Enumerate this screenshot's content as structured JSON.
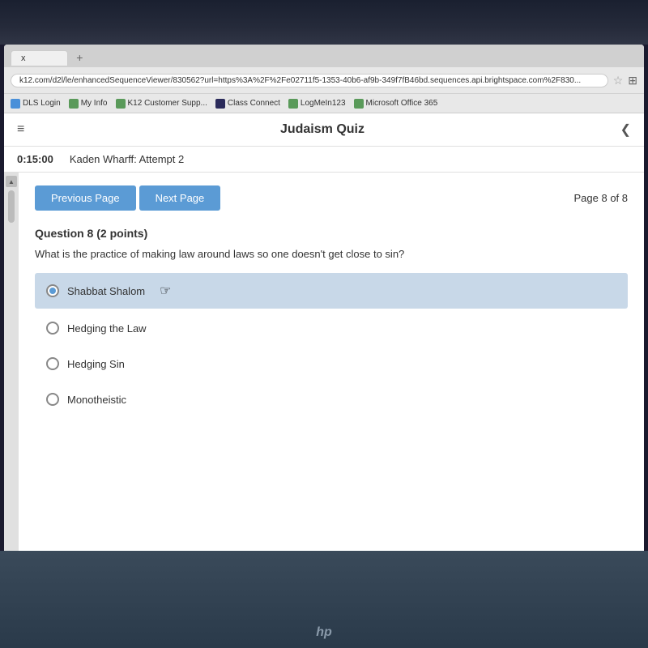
{
  "browser": {
    "url": "k12.com/d2l/le/enhancedSequenceViewer/830562?url=https%3A%2F%2Fe02711f5-1353-40b6-af9b-349f7fB46bd.sequences.api.brightspace.com%2F830...",
    "tab_label": "x",
    "tab_new": "+",
    "bookmarks": [
      {
        "label": "DLS Login",
        "color": "blue"
      },
      {
        "label": "My Info",
        "color": "green"
      },
      {
        "label": "K12 Customer Supp...",
        "color": "green"
      },
      {
        "label": "Class Connect",
        "color": "dark"
      },
      {
        "label": "LogMeIn123",
        "color": "green"
      },
      {
        "label": "Microsoft Office 365",
        "color": "green"
      }
    ]
  },
  "header": {
    "title": "Judaism Quiz",
    "hamburger": "≡",
    "nav_arrow": "❮"
  },
  "timer": {
    "time": "0:15:00",
    "student": "Kaden Wharff: Attempt 2"
  },
  "quiz": {
    "prev_label": "Previous Page",
    "next_label": "Next Page",
    "page_info": "Page 8 of 8",
    "question_label": "Question 8",
    "question_points": "(2 points)",
    "question_text": "What is the practice of making law around laws so one doesn't get close to sin?",
    "options": [
      {
        "id": "opt1",
        "text": "Shabbat Shalom",
        "selected": true
      },
      {
        "id": "opt2",
        "text": "Hedging the Law",
        "selected": false
      },
      {
        "id": "opt3",
        "text": "Hedging Sin",
        "selected": false
      },
      {
        "id": "opt4",
        "text": "Monotheistic",
        "selected": false
      }
    ]
  },
  "laptop": {
    "brand": "hp"
  }
}
